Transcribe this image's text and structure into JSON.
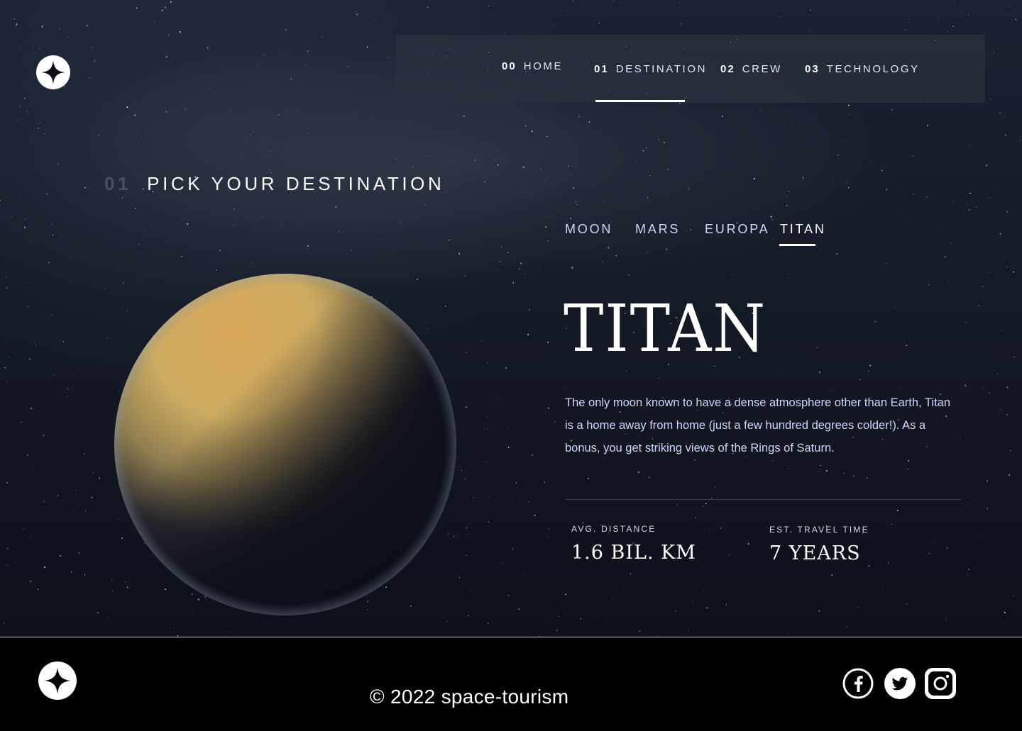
{
  "header": {
    "logo_icon": "star-logo-icon",
    "nav": [
      {
        "num": "00",
        "label": "HOME"
      },
      {
        "num": "01",
        "label": "DESTINATION",
        "active": true
      },
      {
        "num": "02",
        "label": "CREW"
      },
      {
        "num": "03",
        "label": "TECHNOLOGY"
      }
    ]
  },
  "section": {
    "num": "01",
    "title": "PICK YOUR DESTINATION"
  },
  "tabs": [
    {
      "label": "MOON"
    },
    {
      "label": "MARS"
    },
    {
      "label": "EUROPA"
    },
    {
      "label": "TITAN",
      "active": true
    }
  ],
  "destination": {
    "name": "TITAN",
    "description": "The only moon known to have a dense atmosphere other than Earth, Titan is a home away from home (just a few hundred degrees colder!). As a bonus, you get striking views of the Rings of Saturn.",
    "stats": [
      {
        "label": "AVG. DISTANCE",
        "value": "1.6 BIL. KM"
      },
      {
        "label": "EST. TRAVEL TIME",
        "value": "7 YEARS"
      }
    ],
    "planet_icon": "titan-planet-image"
  },
  "footer": {
    "copyright": "© 2022 space-tourism",
    "social": [
      "facebook-icon",
      "twitter-icon",
      "instagram-icon"
    ]
  },
  "colors": {
    "accent": "#ffffff",
    "muted_text": "#d0d6f9",
    "background": "#0b0d17"
  }
}
